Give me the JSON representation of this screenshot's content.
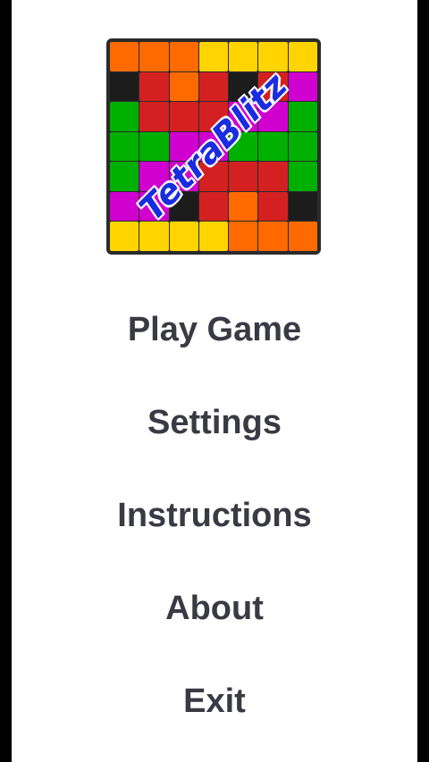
{
  "logo": {
    "text": "TetraBlitz",
    "colors": {
      "O": "#ff6a00",
      "Y": "#ffd400",
      "K": "#1c1c1c",
      "R": "#d42020",
      "G": "#00b000",
      "M": "#d000d0"
    },
    "grid": [
      [
        "O",
        "O",
        "O",
        "Y",
        "Y",
        "Y",
        "Y"
      ],
      [
        "K",
        "R",
        "O",
        "R",
        "K",
        "R",
        "M"
      ],
      [
        "G",
        "R",
        "R",
        "R",
        "M",
        "M",
        "G"
      ],
      [
        "G",
        "G",
        "M",
        "M",
        "G",
        "G",
        "G"
      ],
      [
        "G",
        "M",
        "M",
        "R",
        "R",
        "R",
        "G"
      ],
      [
        "M",
        "M",
        "K",
        "R",
        "O",
        "R",
        "K"
      ],
      [
        "Y",
        "Y",
        "Y",
        "Y",
        "O",
        "O",
        "O"
      ]
    ]
  },
  "menu": {
    "play": "Play Game",
    "settings": "Settings",
    "instructions": "Instructions",
    "about": "About",
    "exit": "Exit"
  }
}
